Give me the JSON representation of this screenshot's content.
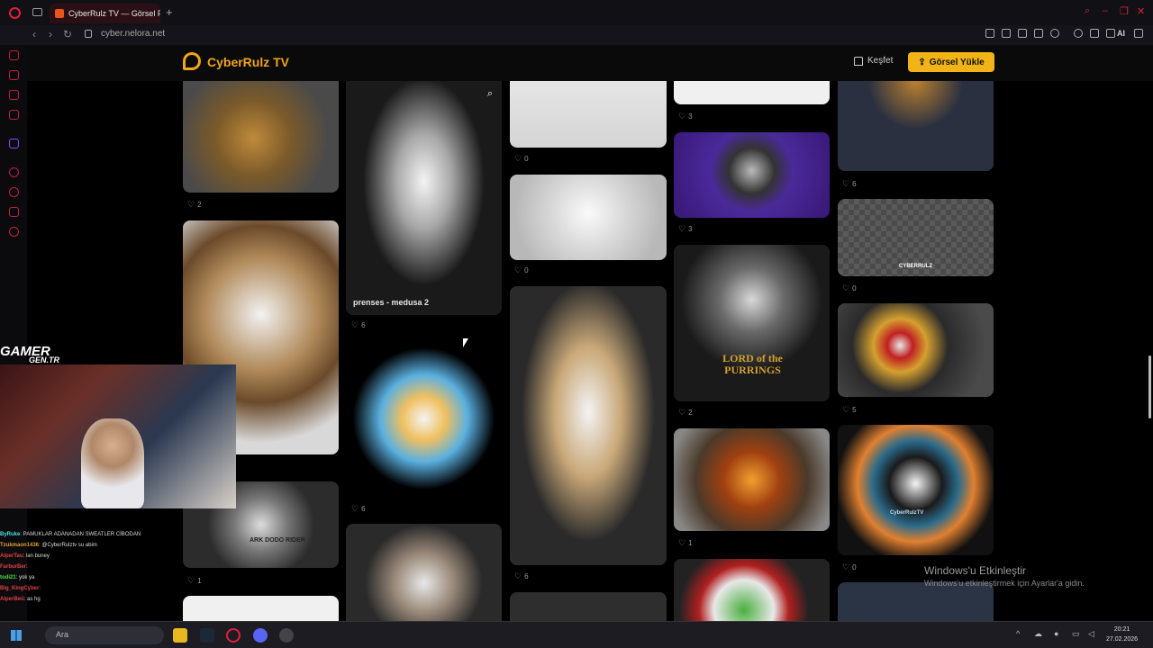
{
  "browser": {
    "tab_title": "CyberRulz TV — Görsel Pa",
    "url": "cyber.nelora.net",
    "ai_label": "AI"
  },
  "site": {
    "logo_text": "CyberRulz TV",
    "explore_label": "Keşfet",
    "upload_label": "Görsel Yükle"
  },
  "gallery": {
    "col1": [
      {
        "likes": "2"
      },
      {
        "likes": ""
      },
      {
        "likes": "1"
      }
    ],
    "col2": [
      {
        "caption": "prenses - medusa 2",
        "likes": "6"
      },
      {
        "likes": "6"
      }
    ],
    "col3": [
      {
        "likes": "0"
      },
      {
        "likes": "0"
      },
      {
        "likes": "6"
      }
    ],
    "col4": [
      {
        "likes": "3"
      },
      {
        "likes": "3"
      },
      {
        "likes": "2"
      },
      {
        "likes": "1"
      }
    ],
    "col5": [
      {
        "likes": "6"
      },
      {
        "likes": "0"
      },
      {
        "likes": "5"
      },
      {
        "likes": "0"
      }
    ],
    "tshirt_text_1": "LORD of the PURRINGS",
    "tshirt_text_2": "ARK DODO RIDER",
    "tshirt_text_3": "CYBERRULZ",
    "tshirt_text_4": "CyberRulzTV"
  },
  "overlay": {
    "gamer_logo": "GAMER",
    "gamer_sub": "GEN.TR",
    "chat": [
      {
        "user": "ByRuke",
        "msg": ": PAMUKLAR ADANADAN SWEATLER CİBODAN"
      },
      {
        "user": "Tzukmaon1436",
        "msg": ": @CyberRulztv su abim"
      },
      {
        "user": "AlperTau",
        "msg": ": lan buney"
      },
      {
        "user": "FarburBer",
        "msg": ":"
      },
      {
        "user": "todi21",
        "msg": ": yok ya"
      },
      {
        "user": "Big_KingCyber",
        "msg": ":"
      },
      {
        "user": "AlperBeü",
        "msg": ": as hg"
      }
    ]
  },
  "windows": {
    "activate_title": "Windows'u Etkinleştir",
    "activate_sub": "Windows'u etkinleştirmek için Ayarlar'a gidin.",
    "search_placeholder": "Ara",
    "time": "20:21",
    "date": "27.02.2026"
  },
  "colors": {
    "accent": "#f2b316",
    "brand_red": "#e0203a"
  }
}
